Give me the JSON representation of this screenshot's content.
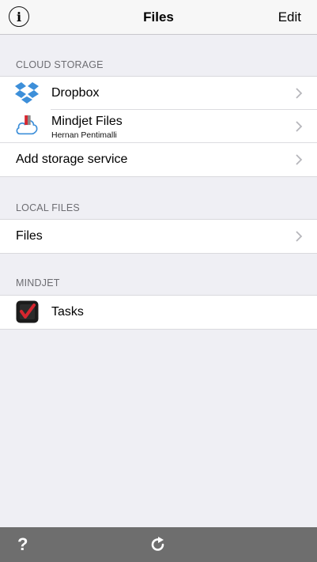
{
  "navbar": {
    "info_icon_glyph": "i",
    "title": "Files",
    "edit_label": "Edit"
  },
  "sections": {
    "cloud": {
      "header": "CLOUD STORAGE",
      "items": [
        {
          "label": "Dropbox",
          "icon": "dropbox-icon"
        },
        {
          "label": "Mindjet Files",
          "sublabel": "Hernan Pentimalli",
          "icon": "mindjet-cloud-icon"
        },
        {
          "label": "Add storage service"
        }
      ]
    },
    "local": {
      "header": "LOCAL FILES",
      "items": [
        {
          "label": "Files"
        }
      ]
    },
    "mindjet": {
      "header": "MINDJET",
      "items": [
        {
          "label": "Tasks",
          "icon": "tasks-app-icon"
        }
      ]
    }
  },
  "toolbar": {
    "help_glyph": "?",
    "refresh_icon": "refresh-icon"
  },
  "colors": {
    "background": "#efeff4",
    "navbar": "#f7f7f7",
    "toolbar": "#6e6e6e",
    "dropbox_blue": "#3d8fd9",
    "mindjet_red": "#d7262f"
  }
}
